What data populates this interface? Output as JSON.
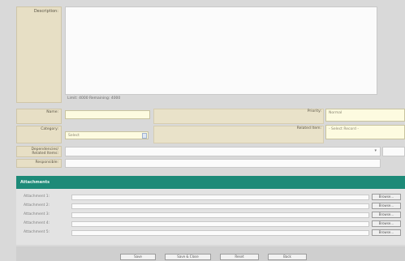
{
  "description": {
    "label": "Description:",
    "char_count": "Limit: 4000 Remaining: 4000"
  },
  "fields": {
    "name": {
      "label": "Name:",
      "value": ""
    },
    "priority": {
      "label": "Priority:",
      "value": "Normal"
    },
    "category": {
      "label": "Category:",
      "value": "Select"
    },
    "related_to": {
      "label": "Related Item:",
      "value": "- Select Record -"
    },
    "dependency": {
      "label": "Dependencies/ Related Items:",
      "value": ""
    },
    "responsible": {
      "label": "Responsible:",
      "value": ""
    }
  },
  "attachments": {
    "header": "Attachments",
    "items": [
      {
        "label": "Attachment 1:",
        "button": "Browse..."
      },
      {
        "label": "Attachment 2:",
        "button": "Browse..."
      },
      {
        "label": "Attachment 3:",
        "button": "Browse..."
      },
      {
        "label": "Attachment 4:",
        "button": "Browse..."
      },
      {
        "label": "Attachment 5:",
        "button": "Browse..."
      }
    ]
  },
  "actions": {
    "save": "Save",
    "save_close": "Save & Close",
    "reset": "Reset",
    "back": "Back"
  }
}
